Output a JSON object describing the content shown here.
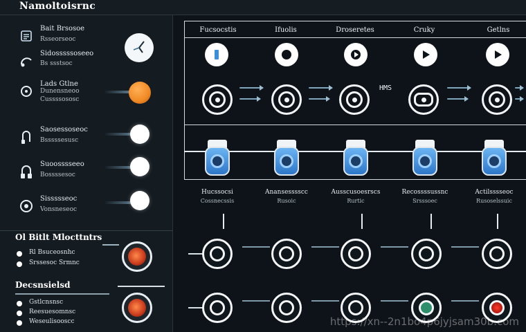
{
  "app": {
    "title": "Namoltoisrnc"
  },
  "left_panel": {
    "rows": [
      {
        "line1": "Bait Brsosoe",
        "line2": "Rsseorseoc",
        "icon": "document-icon"
      },
      {
        "line1": "Sidosssssoseeo",
        "line2": "Bs ssstsoc",
        "icon": "headphone-icon"
      },
      {
        "line1": "Lads Gtlne",
        "line2": "Dunensneoo",
        "line3": "Cussssososc",
        "icon": "headphone-icon"
      },
      {
        "line1": "Saosessoseoc",
        "line2": "Bsssssesusc",
        "icon": "headphone-icon"
      },
      {
        "line1": "Suoosssseeo",
        "line2": "Bossssesoc",
        "icon": "headphone-icon"
      },
      {
        "line1": "Sissssseoc",
        "line2": "Vonsneseoc",
        "icon": "headphone-icon"
      }
    ],
    "section1": {
      "title": "Ol Bitlt Mlocttntrs",
      "items": [
        "Rl Bsuceosnhc",
        "Srssesoc Srmnc"
      ]
    },
    "section2": {
      "title": "Decsnsielsd",
      "items": [
        "Gstlcnsnsc",
        "Reesuesomnsc",
        "Weseulisooscc"
      ]
    }
  },
  "grid": {
    "columns": [
      "Fucsocstis",
      "Ifuolis",
      "Droseretes",
      "Cruky",
      "Getlns"
    ],
    "middle_tag": "HMS"
  },
  "bottom_columns": [
    {
      "label": "Hucssocsi",
      "sub": "Cossnecssis"
    },
    {
      "label": "Anansesssscc",
      "sub": "Rusoic"
    },
    {
      "label": "Ausscusoesrscs",
      "sub": "Rurtic"
    },
    {
      "label": "Recossssussnc",
      "sub": "Srsssoec"
    },
    {
      "label": "Actilsssseoc",
      "sub": "Rusoselssuic"
    }
  ],
  "watermark": "https://xn--2n1bo4p6jyjsam30b.com",
  "colors": {
    "background": "#0d1318",
    "accent_orange": "#f08a24",
    "accent_blue": "#4a9be6",
    "accent_red": "#d8281a"
  }
}
